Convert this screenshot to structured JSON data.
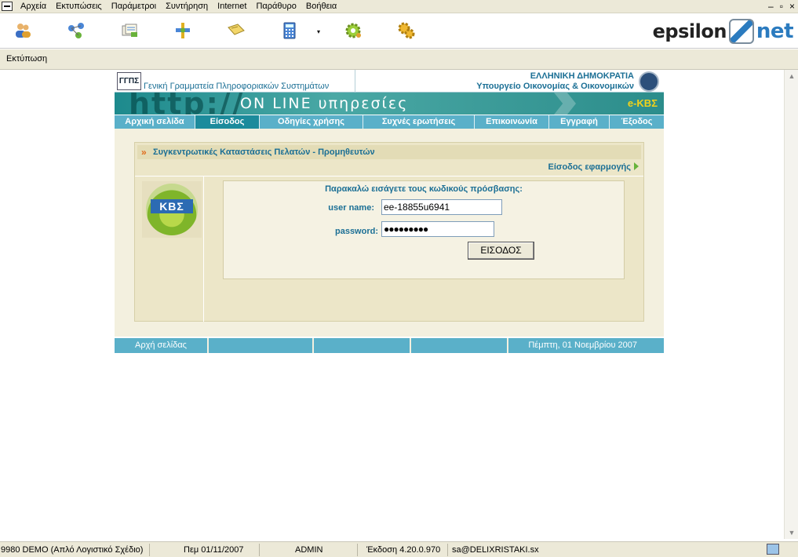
{
  "menu": {
    "items": [
      "Αρχεία",
      "Εκτυπώσεις",
      "Παράμετροι",
      "Συντήρηση",
      "Internet",
      "Παράθυρο",
      "Βοήθεια"
    ],
    "window_controls": [
      "–",
      "▫",
      "×"
    ]
  },
  "toolbar": {
    "icons": [
      "users-icon",
      "network-icon",
      "documents-icon",
      "tools-icon",
      "book-icon",
      "calculator-icon",
      "gear-icon",
      "gears-icon"
    ],
    "dropdown_glyph": "▾",
    "logo_left": "epsilon",
    "logo_right": "net"
  },
  "subbar": {
    "print_label": "Εκτύπωση"
  },
  "site": {
    "header_left": "Γενική Γραμματεία Πληροφοριακών Συστημάτων",
    "header_logo": "ΓΓΠΣ",
    "header_right_1": "ΕΛΛΗΝΙΚΗ ΔΗΜΟΚΡΑΤΙΑ",
    "header_right_2": "Υπουργείο Οικονομίας & Οικονομικών",
    "banner_http": "http://",
    "banner_online": "ON LINE υπηρεσίες",
    "banner_ekbs": "e-ΚΒΣ",
    "nav": [
      "Αρχική σελίδα",
      "Είσοδος",
      "Οδηγίες χρήσης",
      "Συχνές ερωτήσεις",
      "Επικοινωνία",
      "Εγγραφή",
      "Έξοδος"
    ],
    "nav_active": "Είσοδος",
    "panel_title": "Συγκεντρωτικές Καταστάσεις Πελατών - Προμηθευτών",
    "panel_link": "Είσοδος εφαρμογής",
    "kbs_logo_text": "ΚΒΣ",
    "login_prompt": "Παρακαλώ εισάγετε τους κωδικούς πρόσβασης:",
    "username_label": "user name:",
    "username_value": "ee-18855u6941",
    "password_label": "password:",
    "password_value": "●●●●●●●●●",
    "submit_label": "ΕΙΣΟΔΟΣ",
    "footer_home": "Αρχή σελίδας",
    "footer_date": "Πέμπτη, 01 Νοεμβρίου 2007"
  },
  "status": {
    "company": "9980 DEMO (Απλό Λογιστικό Σχέδιο)",
    "date": "Πεμ 01/11/2007",
    "user": "ADMIN",
    "version": "Έκδοση 4.20.0.970",
    "db": "sa@DELIXRISTAKI.sx"
  }
}
